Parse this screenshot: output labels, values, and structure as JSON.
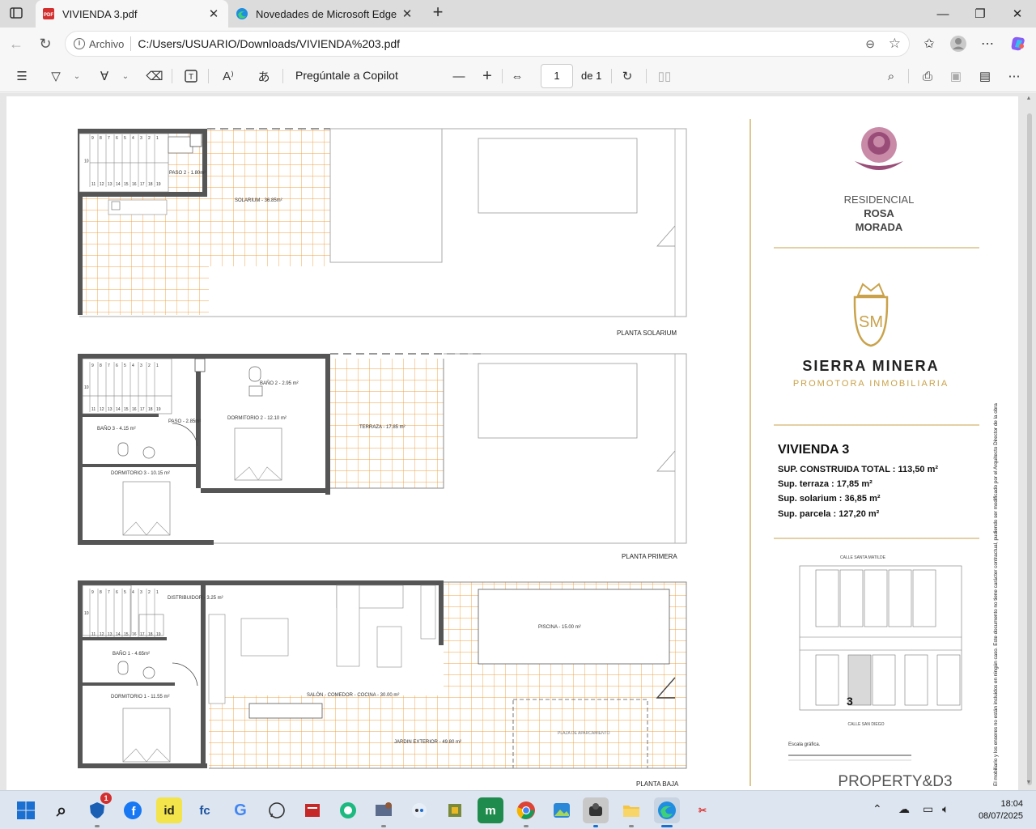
{
  "browser": {
    "tabs": [
      {
        "title": "VIVIENDA 3.pdf",
        "icon": "pdf-icon",
        "active": true
      },
      {
        "title": "Novedades de Microsoft Edge",
        "icon": "edge-icon",
        "active": false
      }
    ],
    "address": {
      "scheme_label": "Archivo",
      "url": "C:/Users/USUARIO/Downloads/VIVIENDA%203.pdf"
    }
  },
  "pdf_toolbar": {
    "copilot_label": "Pregúntale a Copilot",
    "page_current": "1",
    "page_total": "de 1"
  },
  "plan": {
    "labels": {
      "solarium_plan": "PLANTA SOLARIUM",
      "primera_plan": "PLANTA PRIMERA",
      "baja_plan": "PLANTA BAJA",
      "paso2": "PASO 2 - 1.80m²",
      "solarium": "SOLARIUM - 36.85m²",
      "bano2": "BAÑO 2 - 2.95 m²",
      "paso": "PASO - 2.85m²",
      "dorm2": "DORMITORIO 2 - 12.10 m²",
      "terraza": "TERRAZA - 17.85 m²",
      "bano3": "BAÑO 3 - 4.15 m²",
      "dorm3": "DORMITORIO 3 - 10.15 m²",
      "distribuidor": "DISTRIBUIDOR - 3.25 m²",
      "piscina": "PISCINA - 15.00 m²",
      "bano1": "BAÑO 1 - 4.65m²",
      "dorm1": "DORMITORIO 1 - 11.55 m²",
      "salon": "SALÓN - COMEDOR - COCINA - 30.00 m²",
      "jardin": "JARDIN EXTERIOR - 49.80 m²",
      "parking": "PLAZA DE APARCAMIENTO"
    },
    "stairs_top": [
      "9",
      "8",
      "7",
      "6",
      "5",
      "4",
      "3",
      "2",
      "1"
    ],
    "stairs_bottom": [
      "11",
      "12",
      "13",
      "14",
      "15",
      "16",
      "17",
      "18",
      "19"
    ],
    "stair_side": "10"
  },
  "sidebar": {
    "brand1": [
      "RESIDENCIAL",
      "ROSA",
      "MORADA"
    ],
    "brand2_title": "SIERRA MINERA",
    "brand2_sub": "PROMOTORA INMOBILIARIA",
    "monogram": "SM",
    "vivienda_title": "VIVIENDA 3",
    "specs": [
      "SUP. CONSTRUIDA TOTAL : 113,50 m²",
      "Sup. terraza : 17,85 m²",
      "Sup. solarium : 36,85 m²",
      "Sup. parcela : 127,20 m²"
    ],
    "street_top": "CALLE SANTA MATILDE",
    "street_bottom": "CALLE SAN DIEGO",
    "unit_number": "3",
    "scale_label": "Escala gráfica.",
    "vertical_note": "El mobiliario y los enseres no están incluidos en ningún caso. Este documento no tiene carácter contractual, pudiendo ser modificado por el Arquitecto Director de la obra",
    "footer_logo": "PROPERTY&D3",
    "colors": {
      "gold": "#c9a24a",
      "rose": "#9a4c78",
      "floor_grid": "#f0a040"
    }
  },
  "taskbar": {
    "apps": [
      "windows-start",
      "search",
      "copilot",
      "facebook",
      "id",
      "fc",
      "chrome",
      "whatsapp",
      "news",
      "tool-circle",
      "photo-app",
      "chip",
      "spreadsheet",
      "planner",
      "chrome-alt",
      "photos",
      "dark-app",
      "file-explorer",
      "edge"
    ],
    "notification_badge": "1",
    "clock_time": "18:04",
    "clock_date": "08/07/2025"
  }
}
